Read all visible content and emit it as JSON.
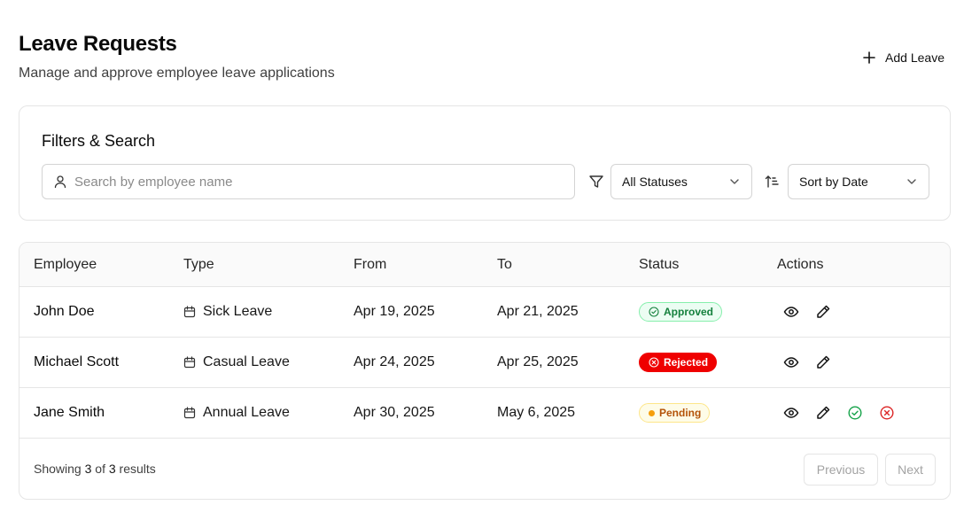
{
  "header": {
    "title": "Leave Requests",
    "subtitle": "Manage and approve employee leave applications",
    "add_label": "Add Leave"
  },
  "filters": {
    "title": "Filters & Search",
    "search_placeholder": "Search by employee name",
    "search_value": "",
    "status_selected": "All Statuses",
    "sort_selected": "Sort by Date"
  },
  "table": {
    "columns": [
      "Employee",
      "Type",
      "From",
      "To",
      "Status",
      "Actions"
    ],
    "rows": [
      {
        "employee": "John Doe",
        "type": "Sick Leave",
        "from": "Apr 19, 2025",
        "to": "Apr 21, 2025",
        "status": "Approved"
      },
      {
        "employee": "Michael Scott",
        "type": "Casual Leave",
        "from": "Apr 24, 2025",
        "to": "Apr 25, 2025",
        "status": "Rejected"
      },
      {
        "employee": "Jane Smith",
        "type": "Annual Leave",
        "from": "Apr 30, 2025",
        "to": "May 6, 2025",
        "status": "Pending"
      }
    ]
  },
  "footer": {
    "showing_prefix": "Showing",
    "shown_count": "3",
    "of_word": "of",
    "total_count": "3",
    "results_word": "results",
    "previous_label": "Previous",
    "next_label": "Next"
  },
  "colors": {
    "approved": "#15803d",
    "rejected": "#ef0000",
    "pending": "#f59e0b",
    "approve_action": "#16a34a",
    "reject_action": "#dc2626"
  },
  "icons": {
    "add": "plus-icon",
    "search": "user-icon",
    "filter": "filter-icon",
    "sort": "sort-icon",
    "type": "calendar-icon",
    "view": "eye-icon",
    "edit": "pencil-icon",
    "approve": "check-circle-icon",
    "reject": "x-circle-icon"
  }
}
